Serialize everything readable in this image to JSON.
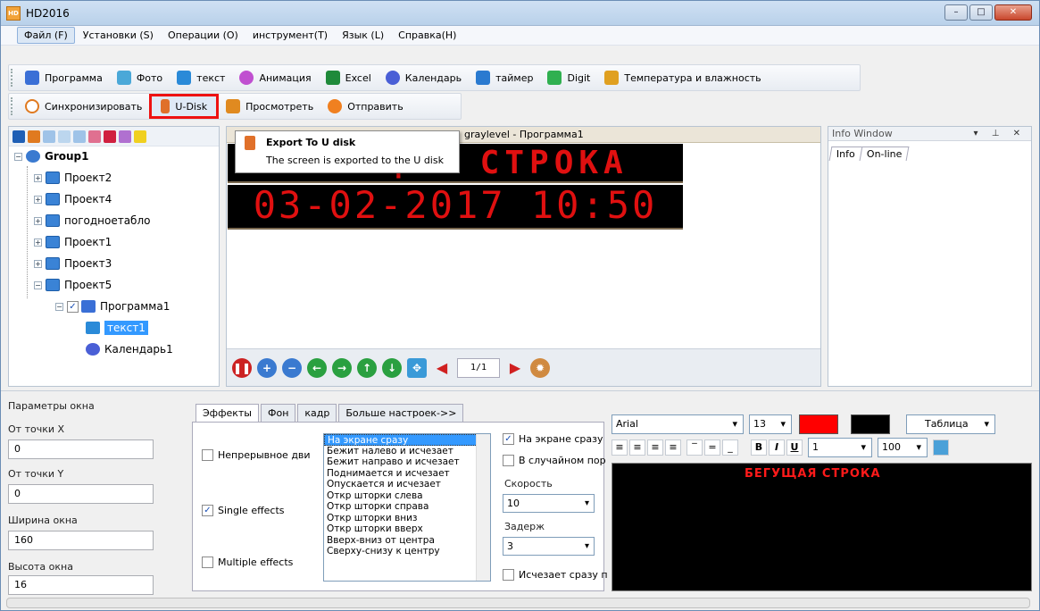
{
  "window": {
    "title": "HD2016",
    "app_icon": "HD"
  },
  "menu": [
    {
      "label": "Файл (F)"
    },
    {
      "label": "Установки (S)"
    },
    {
      "label": "Операции (O)"
    },
    {
      "label": "инструмент(T)"
    },
    {
      "label": "Язык (L)"
    },
    {
      "label": "Справка(H)"
    }
  ],
  "toolbar1": [
    {
      "label": "Программа",
      "icon": "program-icon",
      "color": "#3a6fd6"
    },
    {
      "label": "Фото",
      "icon": "photo-icon",
      "color": "#4aa8d8"
    },
    {
      "label": "текст",
      "icon": "text-icon",
      "color": "#2a8ad8"
    },
    {
      "label": "Анимация",
      "icon": "animation-icon",
      "color": "#c050d0"
    },
    {
      "label": "Excel",
      "icon": "excel-icon",
      "color": "#1f8a3a"
    },
    {
      "label": "Календарь",
      "icon": "calendar-icon",
      "color": "#4a5fd6"
    },
    {
      "label": "таймер",
      "icon": "timer-icon",
      "color": "#2a7ad0"
    },
    {
      "label": "Digit",
      "icon": "digit-icon",
      "color": "#30b050"
    },
    {
      "label": "Температура и влажность",
      "icon": "thermometer-icon",
      "color": "#e0a020"
    }
  ],
  "toolbar2": [
    {
      "label": "Синхронизировать",
      "icon": "sync-icon"
    },
    {
      "label": "U-Disk",
      "icon": "usb-disk-icon"
    },
    {
      "label": "Просмотреть",
      "icon": "camera-icon"
    },
    {
      "label": "Отправить",
      "icon": "send-icon"
    }
  ],
  "tree": {
    "root": "Group1",
    "items": [
      "Проект2",
      "Проект4",
      "погодноетабло",
      "Проект1",
      "Проект3",
      "Проект5"
    ],
    "program": "Программа1",
    "children": [
      "текст1",
      "Календарь1"
    ]
  },
  "preview": {
    "title_prefix": "П",
    "title_suffix": "graylevel - Программа1",
    "line1": "БЕГУЩАЯ СТРОКА",
    "line2": "03-02-2017 10:50",
    "page": "1/1"
  },
  "tooltip": {
    "title": "Export To U disk",
    "desc": "The screen  is exported to the U disk"
  },
  "info_window": {
    "title": "Info Window",
    "tabs": [
      "Info",
      "On-line"
    ]
  },
  "params": {
    "group": "Параметры окна",
    "x_label": "От точки X",
    "x": "0",
    "y_label": "От точки Y",
    "y": "0",
    "w_label": "Ширина окна",
    "w": "160",
    "h_label": "Высота окна",
    "h": "16"
  },
  "effects_tabs": [
    "Эффекты",
    "Фон",
    "кадр",
    "Больше настроек->>"
  ],
  "effects": {
    "continuous": "Непрерывное дви",
    "single": "Single effects",
    "multiple": "Multiple effects",
    "list": [
      "На экране сразу",
      "Бежит налево и исчезает",
      "Бежит направо и исчезает",
      "Поднимается и исчезает",
      "Опускается и исчезает",
      "Откр шторки слева",
      "Откр шторки справа",
      "Откр шторки вниз",
      "Откр шторки вверх",
      "Вверх-вниз от центра",
      "Сверху-снизу к центру"
    ],
    "on_screen": "На экране сразу",
    "random": "В случайном пор",
    "speed_label": "Скорость",
    "speed": "10",
    "delay_label": "Задерж",
    "delay": "3",
    "vanish": "Исчезает сразу п"
  },
  "editor": {
    "font": "Arial",
    "size": "13",
    "fg_color": "#ff0000",
    "bg_color": "#000000",
    "table_label": "Таблица",
    "spacing": "1",
    "zoom": "100",
    "text": "БЕГУЩАЯ СТРОКА"
  }
}
